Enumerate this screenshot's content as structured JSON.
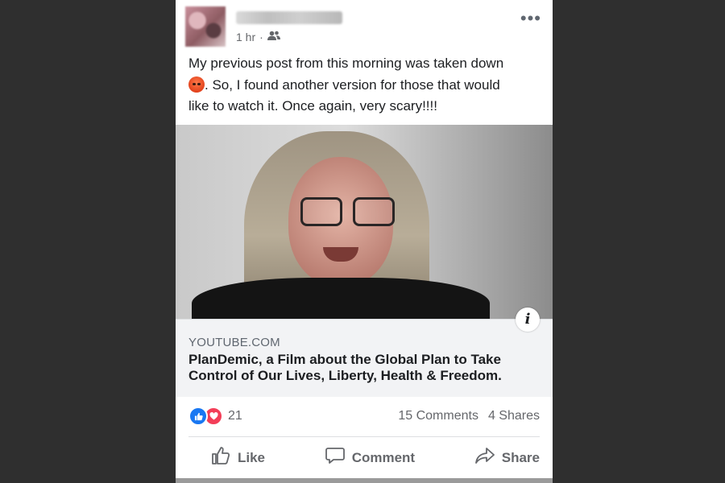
{
  "post": {
    "author_name": "",
    "time": "1 hr",
    "separator": "·",
    "audience_icon": "friends-icon",
    "more_icon": "more-options-icon",
    "text_line1": "My previous post from this morning was taken down",
    "text_line2": ".  So, I found another version for those that would",
    "text_line3": "like to watch it.  Once again, very scary!!!!",
    "emoji": "angry-face-emoji"
  },
  "link": {
    "domain": "YOUTUBE.COM",
    "title": "PlanDemic, a Film about the Global Plan to Take Control of Our Lives, Liberty, Health & Freedom.",
    "info_icon": "i"
  },
  "stats": {
    "reaction_count": "21",
    "comments": "15 Comments",
    "shares": "4 Shares"
  },
  "actions": {
    "like": "Like",
    "comment": "Comment",
    "share": "Share"
  },
  "colors": {
    "like_blue": "#1877f2",
    "love_red": "#f33e58",
    "secondary_text": "#65676b",
    "background": "#2f2f2f"
  }
}
